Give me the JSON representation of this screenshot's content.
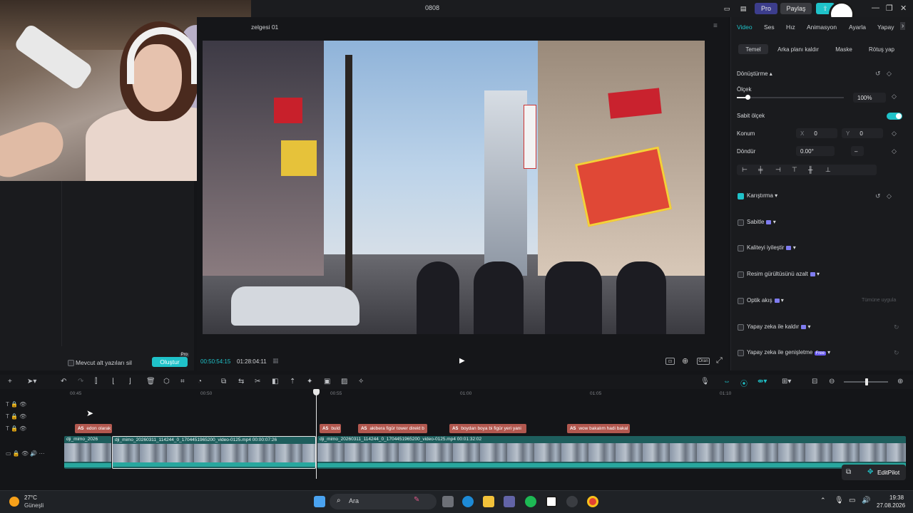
{
  "window": {
    "title": "0808",
    "pro_label": "Pro",
    "share_label": "Paylaş"
  },
  "player": {
    "timeline_name": "zelgesi 01",
    "current_time": "00:50:54:15",
    "total_time": "01:28:04:11",
    "ratio_label": "Oran"
  },
  "left_panel": {
    "remove_subtitles_label": "Mevcut alt yazıları sil",
    "create_button": "Oluştur",
    "create_badge": "Pro"
  },
  "inspector": {
    "tabs": [
      "Video",
      "Ses",
      "Hız",
      "Animasyon",
      "Ayarla",
      "Yapay"
    ],
    "active_tab": "Video",
    "subtabs": [
      "Temel",
      "Arka planı kaldır",
      "Maske",
      "Rötuş yap"
    ],
    "transform_label": "Dönüştürme",
    "scale_label": "Ölçek",
    "scale_value": "100%",
    "scale_fraction": 0.1,
    "uniform_scale_label": "Sabit ölçek",
    "uniform_scale_on": true,
    "position_label": "Konum",
    "pos_x_label": "X",
    "pos_x": "0",
    "pos_y_label": "Y",
    "pos_y": "0",
    "rotate_label": "Döndür",
    "rotate_value": "0.00°",
    "blend_label": "Karıştırma",
    "sections": [
      {
        "label": "Sabitle",
        "pro": true
      },
      {
        "label": "Kaliteyi iyileştir",
        "pro": true
      },
      {
        "label": "Resim gürültüsünü azalt",
        "pro": true
      },
      {
        "label": "Optik akış",
        "pro": true
      },
      {
        "label": "Yapay zeka ile kaldır",
        "pro": true
      },
      {
        "label": "Yapay zeka ile genişletme",
        "pro": false,
        "badge": "Free"
      }
    ],
    "apply_all": "Tümüne uygula"
  },
  "timeline": {
    "ruler_labels": [
      "00:45",
      "00:50",
      "00:55",
      "01:00",
      "01:05",
      "01:10"
    ],
    "captions": [
      {
        "tag": "A5",
        "text": "edon olarak"
      },
      {
        "tag": "A5",
        "text": "buld"
      },
      {
        "tag": "A5",
        "text": "akibera figür tower direkt b"
      },
      {
        "tag": "A5",
        "text": "boydan boya bi figür yeri yani"
      },
      {
        "tag": "A5",
        "text": "wow bakalım hadi bakal"
      }
    ],
    "clips": [
      {
        "name": "dji_mimo_2026",
        "duration": ""
      },
      {
        "name": "dji_mimo_20260311_114244_0_1704451965200_video-0125.mp4",
        "duration": "00:00:07:26"
      },
      {
        "name": "dji_mimo_20260311_114244_0_1704451965200_video-0125.mp4",
        "duration": "00:01:32:02"
      }
    ],
    "editpilot_label": "EditPilot"
  },
  "taskbar": {
    "weather_temp": "27°C",
    "weather_desc": "Güneşli",
    "search_placeholder": "Ara",
    "time": "19:38",
    "date": "27.08.2026"
  },
  "colors": {
    "accent": "#1fc2c9",
    "caption": "#b2584f",
    "clip": "#1e5e5d",
    "pro_gem": "#7f7cf0"
  }
}
